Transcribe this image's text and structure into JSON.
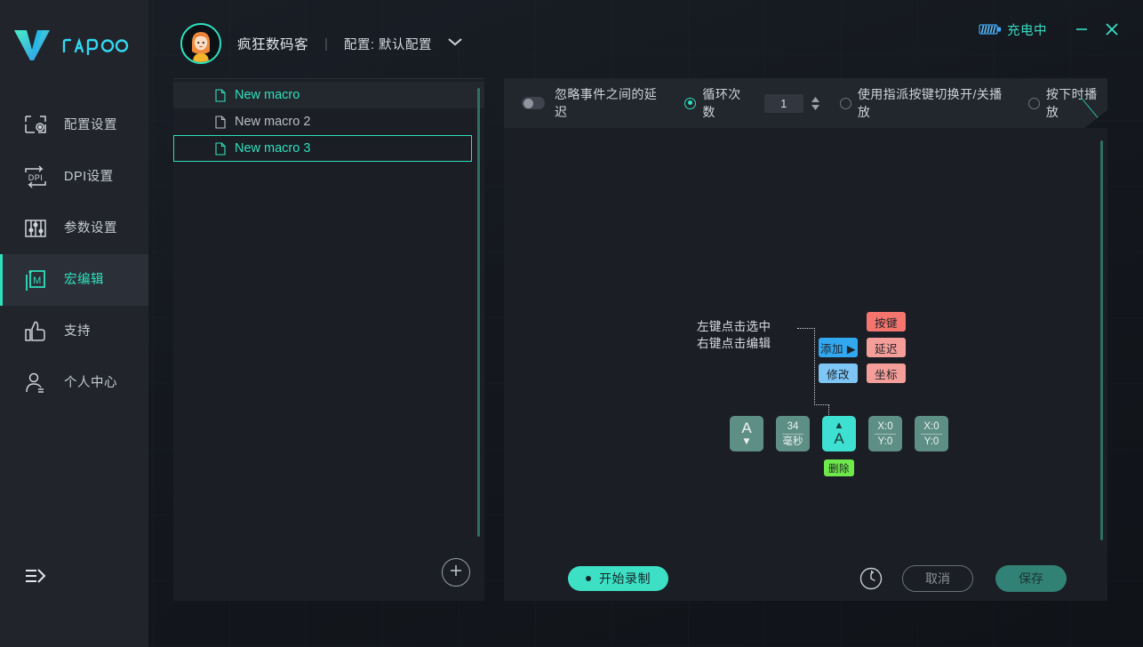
{
  "brand": {
    "name": "rapoo",
    "logo_icon": "rapoo-v-logo"
  },
  "titlebar": {
    "battery_icon": "battery-charging-icon",
    "charge_status": "充电中",
    "minimize_label": "—",
    "close_label": "✕"
  },
  "header": {
    "avatar_icon": "user-avatar",
    "user_name": "疯狂数码客",
    "separator": "|",
    "profile_label": "配置: 默认配置",
    "dropdown_icon": "chevron-down-icon"
  },
  "sidebar": {
    "items": [
      {
        "label": "配置设置",
        "icon": "profile-settings-icon",
        "active": false
      },
      {
        "label": "DPI设置",
        "icon": "dpi-settings-icon",
        "active": false
      },
      {
        "label": "参数设置",
        "icon": "parameter-settings-icon",
        "active": false
      },
      {
        "label": "宏编辑",
        "icon": "macro-edit-icon",
        "active": true
      },
      {
        "label": "支持",
        "icon": "thumbs-up-icon",
        "active": false
      },
      {
        "label": "个人中心",
        "icon": "user-center-icon",
        "active": false
      }
    ],
    "collapse_icon": "collapse-panel-icon"
  },
  "macro_list": {
    "items": [
      {
        "label": "New macro",
        "icon": "document-icon",
        "state": "hover"
      },
      {
        "label": "New macro 2",
        "icon": "document-icon",
        "state": "normal"
      },
      {
        "label": "New macro 3",
        "icon": "document-icon",
        "state": "selected"
      }
    ],
    "add_label": "+",
    "add_icon": "plus-circle-icon"
  },
  "options": {
    "ignore_delay_label": "忽略事件之间的延迟",
    "ignore_delay_on": false,
    "loop_count_label": "循环次数",
    "loop_count_selected": true,
    "loop_count_value": "1",
    "spinner_icon": "spinner-up-down-icon",
    "toggle_play_label": "使用指派按键切换开/关播放",
    "toggle_play_selected": false,
    "hold_play_label": "按下时播放",
    "hold_play_selected": false
  },
  "canvas": {
    "hint_text": "左键点击选中\n右键点击编辑",
    "context_menu": {
      "add_label": "添加 ▶",
      "modify_label": "修改",
      "key_label": "按键",
      "delay_label": "延迟",
      "coord_label": "坐标"
    },
    "delete_tooltip": "删除",
    "events": [
      {
        "type": "key-up",
        "glyph": "A",
        "arrow": "▼",
        "top": "",
        "bottom": "",
        "selected": false
      },
      {
        "type": "delay",
        "glyph": "",
        "arrow": "",
        "top": "34",
        "bottom": "毫秒",
        "selected": false
      },
      {
        "type": "key-down",
        "glyph": "A",
        "arrow": "▲",
        "top": "",
        "bottom": "",
        "selected": true
      },
      {
        "type": "coord",
        "glyph": "",
        "arrow": "",
        "top": "X:0",
        "bottom": "Y:0",
        "selected": false
      },
      {
        "type": "coord",
        "glyph": "",
        "arrow": "",
        "top": "X:0",
        "bottom": "Y:0",
        "selected": false
      }
    ]
  },
  "footer": {
    "record_label": "开始录制",
    "refresh_icon": "refresh-icon",
    "cancel_label": "取消",
    "save_label": "保存"
  },
  "colors": {
    "accent": "#2fe0bd",
    "accent_bright": "#3de0c4",
    "panel": "#1b1e24",
    "rail": "#21242b",
    "blue": "#31a8f0",
    "red": "#f4746e",
    "green": "#6ee84a"
  }
}
